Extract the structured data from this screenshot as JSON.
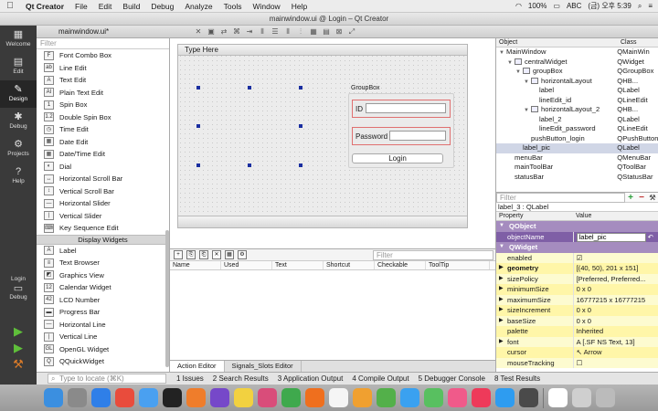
{
  "menubar": {
    "apple_icon": "apple-icon",
    "items": [
      "Qt Creator",
      "File",
      "Edit",
      "Build",
      "Debug",
      "Analyze",
      "Tools",
      "Window",
      "Help"
    ],
    "battery": "100%",
    "input": "ABC",
    "clock": "(금) 오후 5:39"
  },
  "window": {
    "title": "mainwindow.ui @ Login – Qt Creator"
  },
  "modes": [
    {
      "label": "Welcome",
      "icon": "▦"
    },
    {
      "label": "Edit",
      "icon": "▤"
    },
    {
      "label": "Design",
      "icon": "✎"
    },
    {
      "label": "Debug",
      "icon": "✱"
    },
    {
      "label": "Projects",
      "icon": "⚙"
    },
    {
      "label": "Help",
      "icon": "?"
    }
  ],
  "mode_bottom": {
    "label": "Login",
    "sub": "Debug"
  },
  "filebar": {
    "filename": "mainwindow.ui*"
  },
  "widgetbox": {
    "filter_placeholder": "Filter",
    "items_top": [
      {
        "label": "Font Combo Box",
        "icon": "F"
      },
      {
        "label": "Line Edit",
        "icon": "ab"
      },
      {
        "label": "Text Edit",
        "icon": "A"
      },
      {
        "label": "Plain Text Edit",
        "icon": "AI"
      },
      {
        "label": "Spin Box",
        "icon": "1"
      },
      {
        "label": "Double Spin Box",
        "icon": "1.2"
      },
      {
        "label": "Time Edit",
        "icon": "◷"
      },
      {
        "label": "Date Edit",
        "icon": "▦"
      },
      {
        "label": "Date/Time Edit",
        "icon": "▦"
      },
      {
        "label": "Dial",
        "icon": "◐"
      },
      {
        "label": "Horizontal Scroll Bar",
        "icon": "↔"
      },
      {
        "label": "Vertical Scroll Bar",
        "icon": "↕"
      },
      {
        "label": "Horizontal Slider",
        "icon": "—"
      },
      {
        "label": "Vertical Slider",
        "icon": "|"
      },
      {
        "label": "Key Sequence Edit",
        "icon": "⌨"
      }
    ],
    "category": "Display Widgets",
    "items_display": [
      {
        "label": "Label",
        "icon": "A"
      },
      {
        "label": "Text Browser",
        "icon": "≡"
      },
      {
        "label": "Graphics View",
        "icon": "◩"
      },
      {
        "label": "Calendar Widget",
        "icon": "12"
      },
      {
        "label": "LCD Number",
        "icon": "42"
      },
      {
        "label": "Progress Bar",
        "icon": "▬"
      },
      {
        "label": "Horizontal Line",
        "icon": "—"
      },
      {
        "label": "Vertical Line",
        "icon": "|"
      },
      {
        "label": "OpenGL Widget",
        "icon": "GL"
      },
      {
        "label": "QQuickWidget",
        "icon": "Q"
      }
    ]
  },
  "form": {
    "menu_placeholder": "Type Here",
    "groupbox_title": "GroupBox",
    "id_label": "ID",
    "password_label": "Password",
    "login_button": "Login"
  },
  "action_editor": {
    "filter_placeholder": "Filter",
    "columns": [
      "Name",
      "Used",
      "Text",
      "Shortcut",
      "Checkable",
      "ToolTip"
    ],
    "tabs": [
      "Action Editor",
      "Signals_Slots Editor"
    ]
  },
  "object_inspector": {
    "headers": [
      "Object",
      "Class"
    ],
    "rows": [
      {
        "name": "MainWindow",
        "cls": "QMainWin",
        "indent": 0,
        "twisty": "▼",
        "icon": false
      },
      {
        "name": "centralWidget",
        "cls": "QWidget",
        "indent": 1,
        "twisty": "▼",
        "icon": true
      },
      {
        "name": "groupBox",
        "cls": "QGroupBox",
        "indent": 2,
        "twisty": "▼",
        "icon": true
      },
      {
        "name": "horizontalLayout",
        "cls": "QHB...",
        "indent": 3,
        "twisty": "▼",
        "icon": true
      },
      {
        "name": "label",
        "cls": "QLabel",
        "indent": 4,
        "twisty": "",
        "icon": false
      },
      {
        "name": "lineEdit_id",
        "cls": "QLineEdit",
        "indent": 4,
        "twisty": "",
        "icon": false
      },
      {
        "name": "horizontalLayout_2",
        "cls": "QHB...",
        "indent": 3,
        "twisty": "▼",
        "icon": true
      },
      {
        "name": "label_2",
        "cls": "QLabel",
        "indent": 4,
        "twisty": "",
        "icon": false
      },
      {
        "name": "lineEdit_password",
        "cls": "QLineEdit",
        "indent": 4,
        "twisty": "",
        "icon": false
      },
      {
        "name": "pushButton_login",
        "cls": "QPushButton",
        "indent": 3,
        "twisty": "",
        "icon": false
      },
      {
        "name": "label_pic",
        "cls": "QLabel",
        "indent": 2,
        "twisty": "",
        "icon": false,
        "selected": true
      },
      {
        "name": "menuBar",
        "cls": "QMenuBar",
        "indent": 1,
        "twisty": "",
        "icon": false
      },
      {
        "name": "mainToolBar",
        "cls": "QToolBar",
        "indent": 1,
        "twisty": "",
        "icon": false
      },
      {
        "name": "statusBar",
        "cls": "QStatusBar",
        "indent": 1,
        "twisty": "",
        "icon": false
      }
    ]
  },
  "property_editor": {
    "filter_placeholder": "Filter",
    "object_title": "label_3 : QLabel",
    "headers": [
      "Property",
      "Value"
    ],
    "rows": [
      {
        "kind": "sect",
        "name": "QObject",
        "value": ""
      },
      {
        "kind": "selr",
        "name": "objectName",
        "value": "label_pic",
        "edit": true
      },
      {
        "kind": "sect",
        "name": "QWidget",
        "value": ""
      },
      {
        "kind": "y",
        "name": "enabled",
        "value": "☑"
      },
      {
        "kind": "y2",
        "name": "geometry",
        "value": "[(40, 50), 201 x 151]",
        "bold": true,
        "arrow": "▶"
      },
      {
        "kind": "y",
        "name": "sizePolicy",
        "value": "[Preferred, Preferred...",
        "arrow": "▶"
      },
      {
        "kind": "y2",
        "name": "minimumSize",
        "value": "0 x 0",
        "arrow": "▶"
      },
      {
        "kind": "y",
        "name": "maximumSize",
        "value": "16777215 x 16777215",
        "arrow": "▶"
      },
      {
        "kind": "y2",
        "name": "sizeIncrement",
        "value": "0 x 0",
        "arrow": "▶"
      },
      {
        "kind": "y",
        "name": "baseSize",
        "value": "0 x 0",
        "arrow": "▶"
      },
      {
        "kind": "y2",
        "name": "palette",
        "value": "Inherited"
      },
      {
        "kind": "y",
        "name": "font",
        "value": "A  [.SF NS Text, 13]",
        "arrow": "▶"
      },
      {
        "kind": "y2",
        "name": "cursor",
        "value": "↖  Arrow"
      },
      {
        "kind": "y",
        "name": "mouseTracking",
        "value": "☐"
      }
    ]
  },
  "output_bar": {
    "locate_placeholder": "Type to locate (⌘K)",
    "tabs": [
      "1  Issues",
      "2  Search Results",
      "3  Application Output",
      "4  Compile Output",
      "5  Debugger Console",
      "8  Test Results"
    ]
  },
  "dock": {
    "colors": [
      "#3b8fe0",
      "#8a8a8a",
      "#2f7fe8",
      "#e94c3c",
      "#4aa0f0",
      "#222",
      "#ef7d2b",
      "#7648c9",
      "#f2d140",
      "#d94d7a",
      "#3fa94d",
      "#ef6f1e",
      "#f5f5f5",
      "#f0a030",
      "#53b04a",
      "#3aa1f0",
      "#58c060",
      "#f05a8a",
      "#ee3a5a",
      "#2e9cf0",
      "#4a4a4a",
      "#fff",
      "#cfcfcf",
      "#bbb"
    ]
  }
}
